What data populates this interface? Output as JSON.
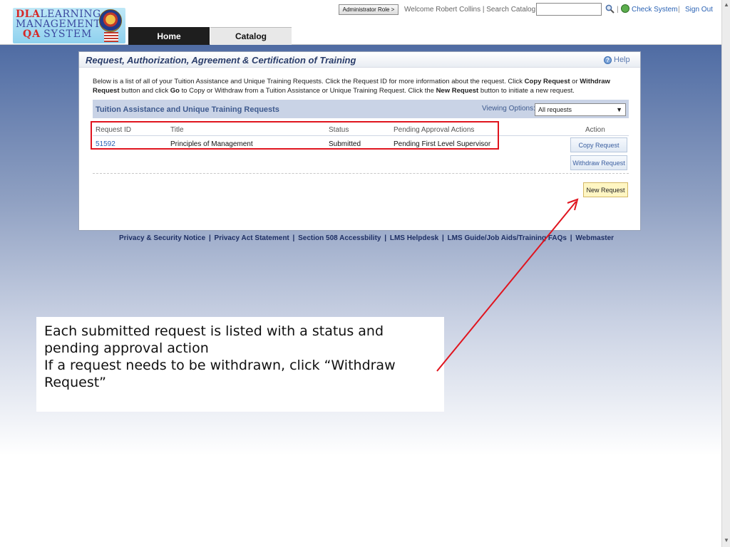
{
  "header": {
    "logo": {
      "line1_dla": "DLA",
      "line1_rest": "LEARNING",
      "line2": "MANAGEMENT",
      "line3_qa": "QA",
      "line3_rest": "SYSTEM"
    },
    "nav": [
      {
        "label": "Home"
      },
      {
        "label": "Catalog"
      }
    ],
    "role_button": "Administrator Role >",
    "welcome_text": "Welcome Robert Collins | Search Catalog",
    "search_value": "",
    "check_system": "Check System",
    "sign_out": "Sign Out"
  },
  "panel": {
    "title": "Request, Authorization, Agreement & Certification of Training",
    "help": "Help",
    "intro_1": "Below is a list of all of your Tuition Assistance and Unique Training Requests. Click the Request ID for more information about the request. Click ",
    "intro_copy": "Copy Request",
    "intro_2": " or ",
    "intro_withdraw": "Withdraw Request",
    "intro_3": " button and click ",
    "intro_go": "Go",
    "intro_4": " to Copy or Withdraw from a Tuition Assistance or Unique Training Request. Click the ",
    "intro_new": "New Request",
    "intro_5": " button to initiate a new request.",
    "section_title": "Tuition Assistance and Unique Training Requests",
    "viewing_options_label": "Viewing Options:",
    "viewing_options_value": "All requests",
    "columns": [
      "Request ID",
      "Title",
      "Status",
      "Pending Approval Actions",
      "Action"
    ],
    "rows": [
      {
        "request_id": "51592",
        "title": "Principles of Management",
        "status": "Submitted",
        "pending": "Pending First Level Supervisor"
      }
    ],
    "copy_request": "Copy Request",
    "withdraw_request": "Withdraw Request",
    "new_request": "New Request"
  },
  "footer": {
    "links": [
      "Privacy & Security Notice",
      "Privacy Act Statement",
      "Section 508 Accessbility",
      "LMS Helpdesk",
      "LMS Guide/Job Aids/Training FAQs",
      "Webmaster"
    ]
  },
  "callout": {
    "line1": "Each submitted request is listed with a status and pending approval action",
    "line2": "If a request needs to be withdrawn, click “Withdraw Request”"
  },
  "colors": {
    "highlight": "#e0141e",
    "header_blue": "#3d5a94",
    "link_blue": "#2a62b4"
  }
}
